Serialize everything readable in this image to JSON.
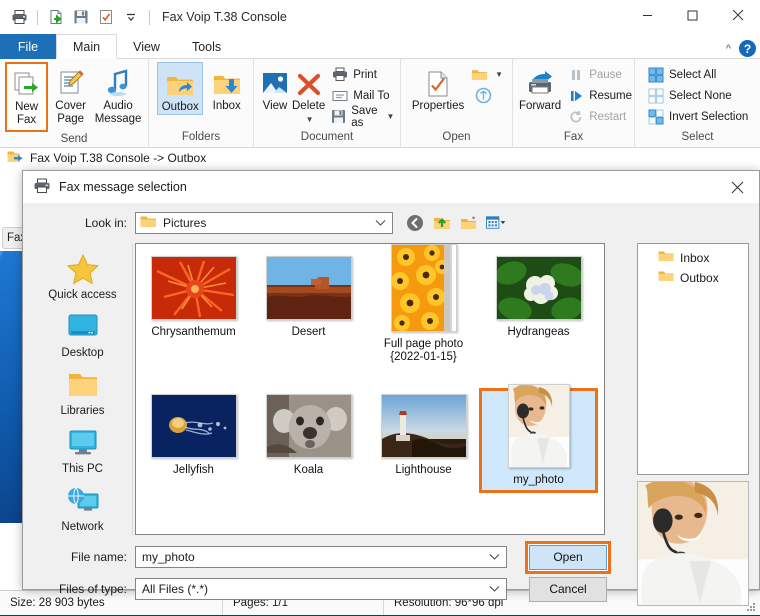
{
  "app": {
    "title": "Fax Voip T.38 Console",
    "quick_access": [
      "printer-icon",
      "export-icon",
      "save-icon",
      "checkmark-doc-icon",
      "qat-dropdown-icon"
    ],
    "window_controls": {
      "minimize": "minimize-icon",
      "maximize": "maximize-icon",
      "close": "close-icon"
    },
    "ribbon_collapse": "chevron-up-icon",
    "help": "?"
  },
  "tabs": [
    {
      "label": "File",
      "active": false,
      "style": "file"
    },
    {
      "label": "Main",
      "active": true,
      "style": "normal"
    },
    {
      "label": "View",
      "active": false,
      "style": "normal"
    },
    {
      "label": "Tools",
      "active": false,
      "style": "normal"
    }
  ],
  "ribbon": {
    "groups": [
      {
        "label": "Send",
        "buttons": [
          {
            "label": "New Fax",
            "icon": "new-fax-icon",
            "highlighted": true
          },
          {
            "label": "Cover Page",
            "icon": "cover-page-icon"
          },
          {
            "label": "Audio Message",
            "icon": "audio-message-icon"
          }
        ]
      },
      {
        "label": "Folders",
        "buttons": [
          {
            "label": "Outbox",
            "icon": "outbox-folder-icon",
            "selected": true
          },
          {
            "label": "Inbox",
            "icon": "inbox-folder-icon"
          }
        ]
      },
      {
        "label": "Document",
        "buttons": [
          {
            "label": "View",
            "icon": "view-image-icon"
          },
          {
            "label": "Delete",
            "icon": "delete-x-icon",
            "has_menu": true
          }
        ],
        "small_buttons": [
          {
            "label": "Print",
            "icon": "print-icon"
          },
          {
            "label": "Mail To",
            "icon": "mail-to-icon"
          },
          {
            "label": "Save as",
            "icon": "save-as-icon",
            "has_menu": true
          }
        ]
      },
      {
        "label": "Open",
        "buttons": [
          {
            "label": "Properties",
            "icon": "properties-icon"
          }
        ],
        "small_buttons": [
          {
            "label": "",
            "icon": "open-folder-icon",
            "has_menu": true
          },
          {
            "label": "",
            "icon": "refresh-icon"
          }
        ]
      },
      {
        "label": "Fax",
        "buttons": [
          {
            "label": "Forward",
            "icon": "forward-fax-icon"
          }
        ],
        "small_buttons": [
          {
            "label": "Pause",
            "icon": "pause-icon",
            "disabled": true
          },
          {
            "label": "Resume",
            "icon": "resume-icon",
            "disabled": false
          },
          {
            "label": "Restart",
            "icon": "restart-icon",
            "disabled": true
          }
        ]
      },
      {
        "label": "Select",
        "small_buttons": [
          {
            "label": "Select All",
            "icon": "select-all-icon"
          },
          {
            "label": "Select None",
            "icon": "select-none-icon"
          },
          {
            "label": "Invert Selection",
            "icon": "invert-selection-icon"
          }
        ]
      }
    ]
  },
  "breadcrumb": {
    "icon": "folder-arrow-icon",
    "text": "Fax Voip T.38 Console -> Outbox"
  },
  "behind": {
    "tab_label": "Fax"
  },
  "dialog": {
    "title": "Fax message selection",
    "title_icon": "fax-printer-icon",
    "close_icon": "close-icon",
    "look_in": {
      "label": "Look in:",
      "value": "Pictures",
      "icon": "folder-icon",
      "nav": [
        "back-icon",
        "up-folder-icon",
        "new-folder-icon",
        "view-mode-icon"
      ]
    },
    "places": [
      {
        "label": "Quick access",
        "icon": "star-icon"
      },
      {
        "label": "Desktop",
        "icon": "desktop-icon"
      },
      {
        "label": "Libraries",
        "icon": "libraries-folder-icon"
      },
      {
        "label": "This PC",
        "icon": "this-pc-icon"
      },
      {
        "label": "Network",
        "icon": "network-icon"
      }
    ],
    "files": [
      {
        "name": "Chrysanthemum",
        "thumb": "chrysanthemum",
        "selected": false
      },
      {
        "name": "Desert",
        "thumb": "desert",
        "selected": false
      },
      {
        "name": "Full page photo {2022-01-15}",
        "thumb": "full-page-photo",
        "selected": false,
        "tall": true
      },
      {
        "name": "Hydrangeas",
        "thumb": "hydrangeas",
        "selected": false
      },
      {
        "name": "Jellyfish",
        "thumb": "jellyfish",
        "selected": false
      },
      {
        "name": "Koala",
        "thumb": "koala",
        "selected": false
      },
      {
        "name": "Lighthouse",
        "thumb": "lighthouse",
        "selected": false
      },
      {
        "name": "my_photo",
        "thumb": "my-photo",
        "selected": true,
        "portrait": true
      }
    ],
    "tree": [
      {
        "label": "Inbox",
        "icon": "folder-icon"
      },
      {
        "label": "Outbox",
        "icon": "folder-icon"
      }
    ],
    "preview": {
      "name": "my-photo-preview"
    },
    "file_name": {
      "label": "File name:",
      "value": "my_photo"
    },
    "files_of_type": {
      "label": "Files of type:",
      "value": "All Files (*.*)"
    },
    "buttons": {
      "open": {
        "label": "Open",
        "highlighted": true
      },
      "cancel": {
        "label": "Cancel",
        "highlighted": false
      }
    }
  },
  "status": {
    "size": "Size: 28 903 bytes",
    "pages": "Pages: 1/1",
    "resolution": "Resolution: 96*96 dpi"
  },
  "colors": {
    "accent_orange": "#ec7117",
    "tab_blue": "#1d6fb8",
    "selection_blue": "#cfe8fb"
  }
}
